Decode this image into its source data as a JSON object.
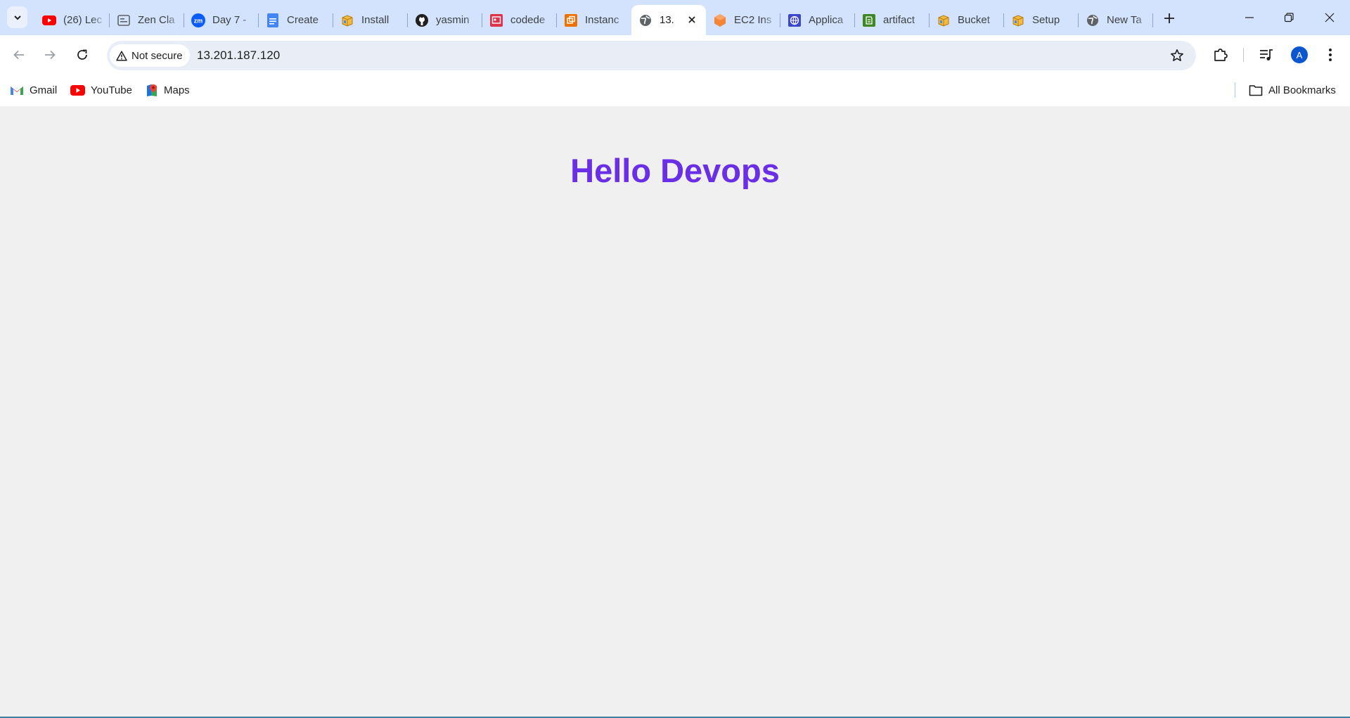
{
  "browser": {
    "tabs": [
      {
        "title": "(26) Lec",
        "icon": "youtube-icon",
        "active": false
      },
      {
        "title": "Zen Cla",
        "icon": "zen-class-icon",
        "active": false
      },
      {
        "title": "Day 7 -",
        "icon": "zoom-icon",
        "active": false
      },
      {
        "title": "Create",
        "icon": "google-docs-icon",
        "active": false
      },
      {
        "title": "Install",
        "icon": "package-icon",
        "active": false
      },
      {
        "title": "yasmin",
        "icon": "github-icon",
        "active": false
      },
      {
        "title": "codede",
        "icon": "aws-codedeploy-icon",
        "active": false
      },
      {
        "title": "Instanc",
        "icon": "aws-instance-icon",
        "active": false
      },
      {
        "title": "13.",
        "icon": "globe-icon",
        "active": true
      },
      {
        "title": "EC2 Ins",
        "icon": "aws-ec2-icon",
        "active": false
      },
      {
        "title": "Applica",
        "icon": "web-app-icon",
        "active": false
      },
      {
        "title": "artifact",
        "icon": "aws-codeartifact-icon",
        "active": false
      },
      {
        "title": "Bucket",
        "icon": "package-icon",
        "active": false
      },
      {
        "title": "Setup",
        "icon": "package-icon",
        "active": false
      },
      {
        "title": "New Ta",
        "icon": "globe-icon",
        "active": false
      }
    ],
    "address": {
      "security_label": "Not secure",
      "url": "13.201.187.120"
    },
    "profile_initial": "A",
    "bookmarks": [
      {
        "label": "Gmail",
        "icon": "gmail-icon"
      },
      {
        "label": "YouTube",
        "icon": "youtube-icon"
      },
      {
        "label": "Maps",
        "icon": "maps-icon"
      }
    ],
    "all_bookmarks_label": "All Bookmarks"
  },
  "page": {
    "heading": "Hello Devops"
  },
  "colors": {
    "heading": "#6a2ee6",
    "page_background": "#f0f0f0",
    "tabstrip": "#d3e3fd"
  }
}
